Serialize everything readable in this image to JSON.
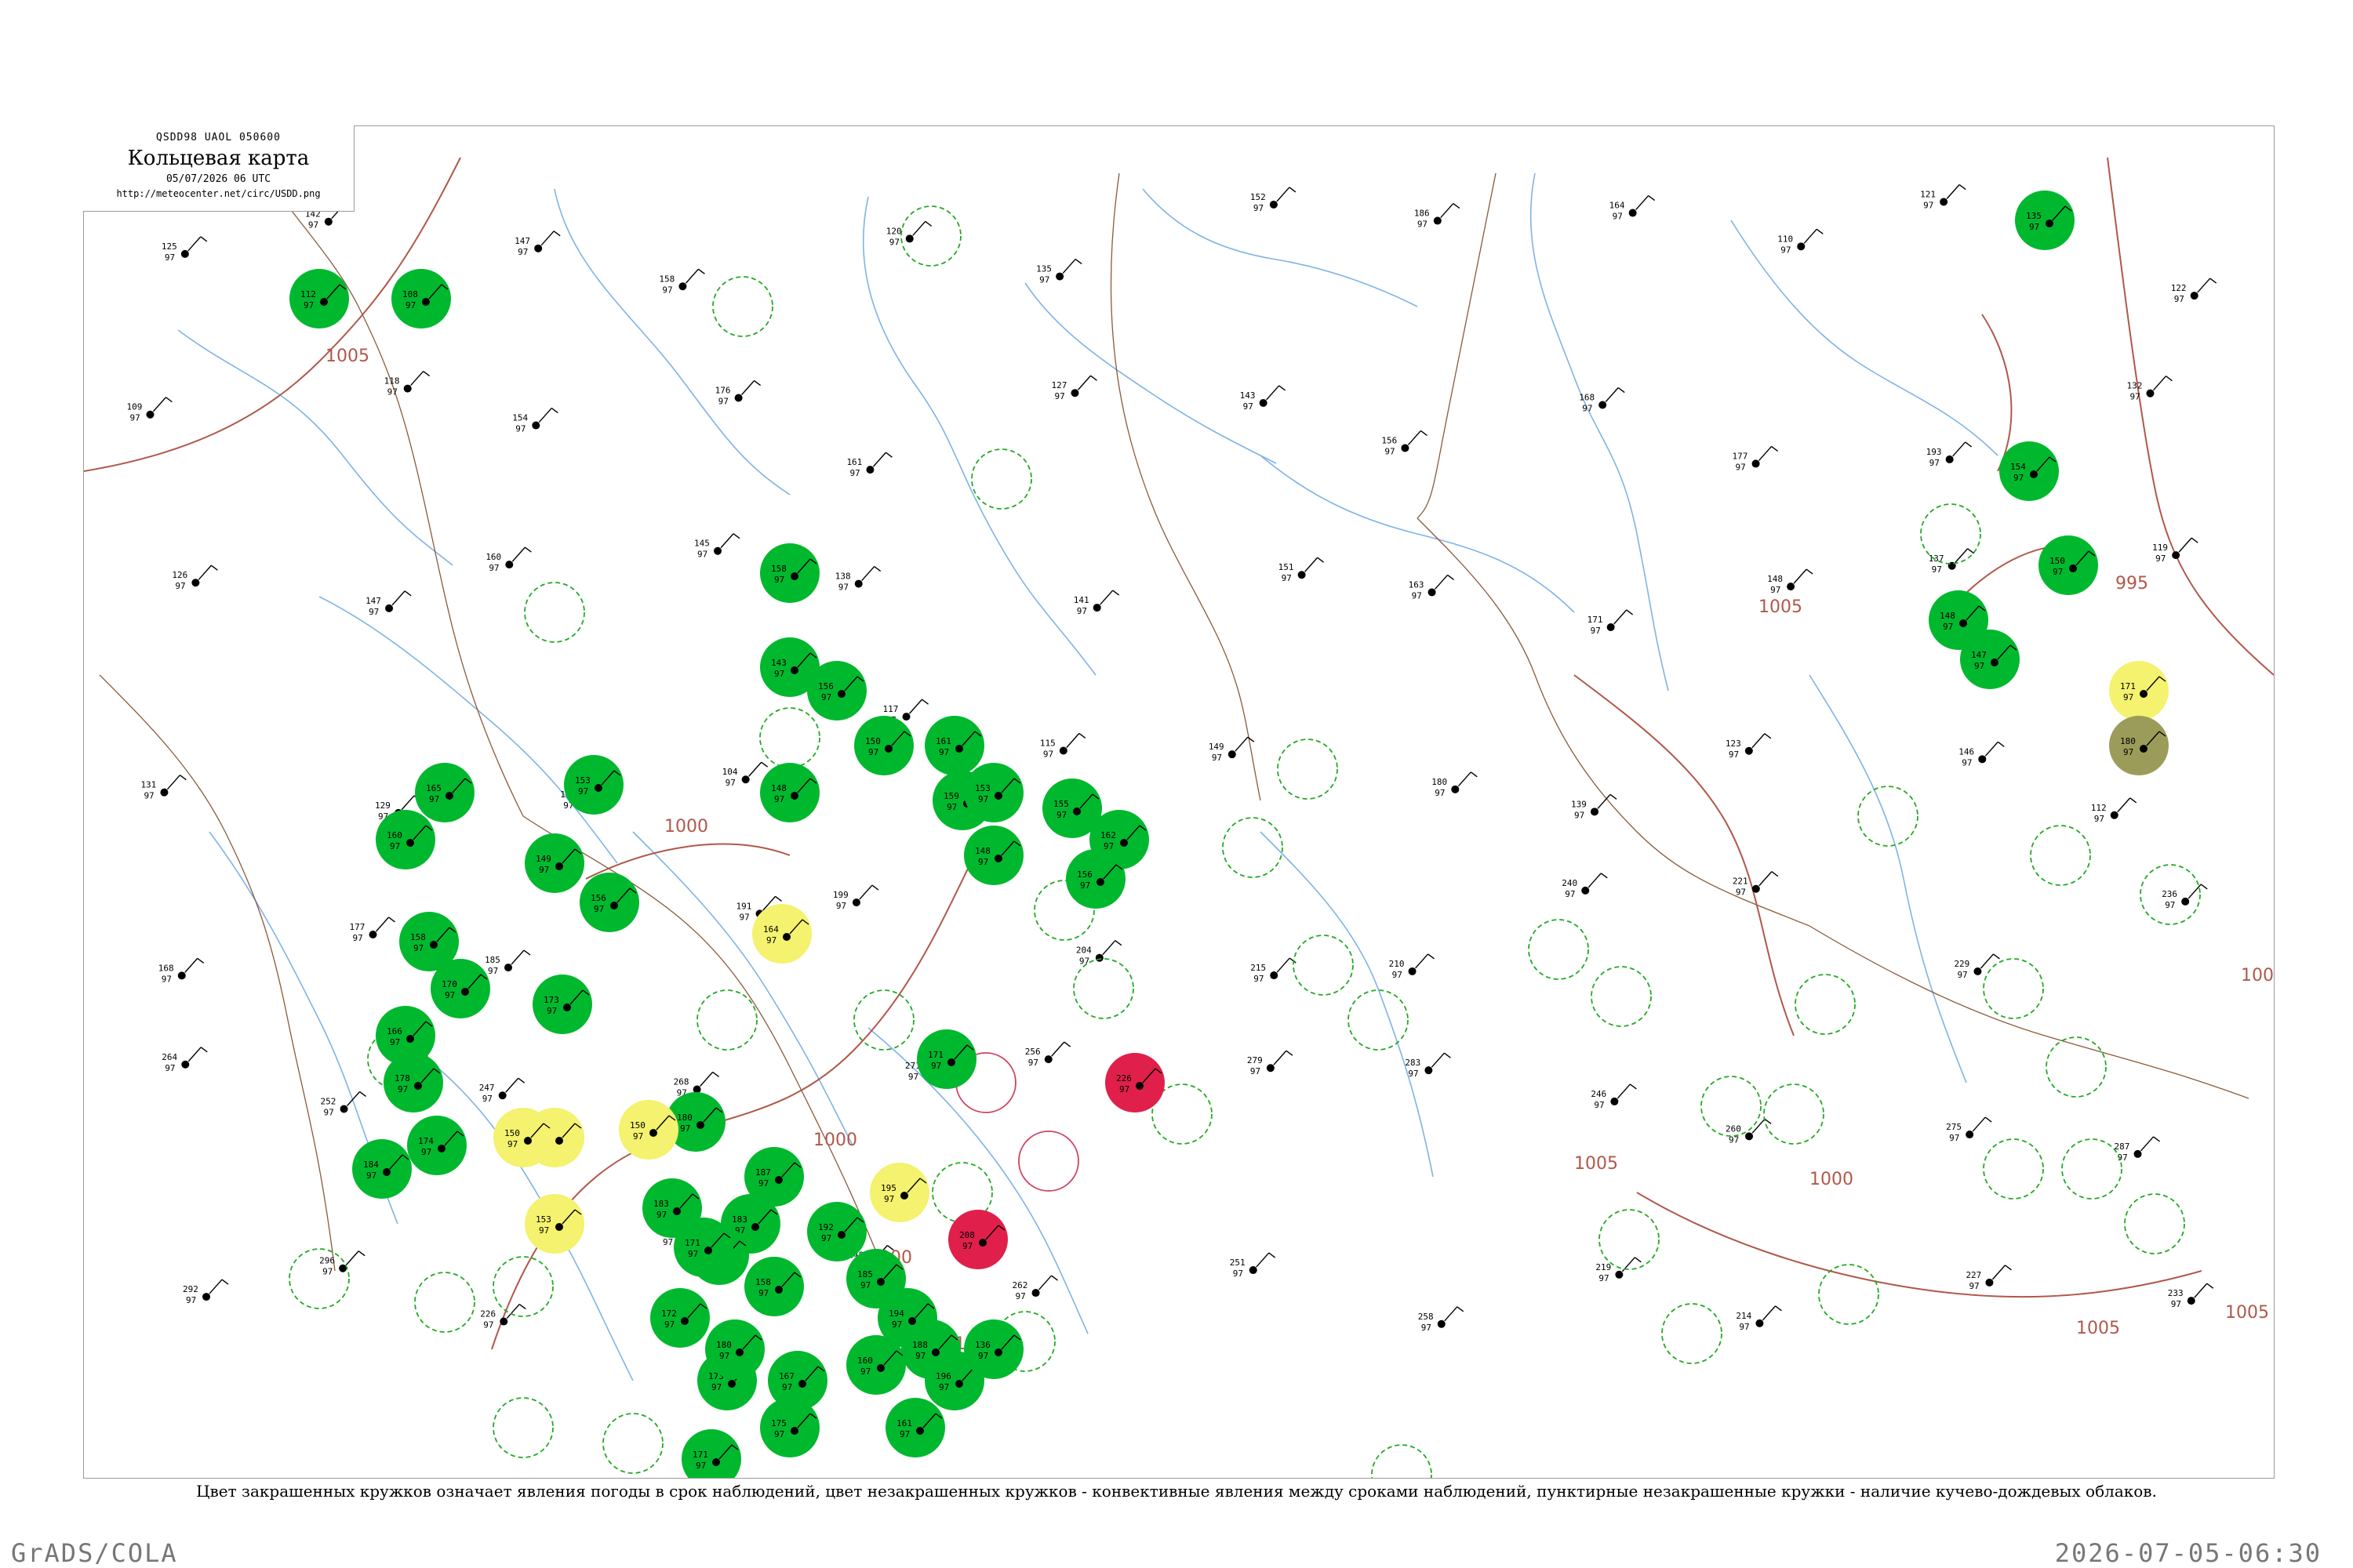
{
  "header": {
    "code": "QSDD98  UAOL  050600",
    "title": "Кольцевая карта",
    "date": "05/07/2026 06 UTC",
    "url": "http://meteocenter.net/circ/USDD.png"
  },
  "caption": "Цвет закрашенных кружков означает явления погоды в срок наблюдений, цвет незакрашенных кружков - конвективные явления между сроками наблюдений, пунктирные незакрашенные кружки - наличие кучево-дождевых облаков.",
  "footer": {
    "left": "GrADS/COLA",
    "right": "2026-07-05-06:30"
  },
  "colors": {
    "rain": "#00b82e",
    "drizzle": "#f4f26e",
    "shower_hail": "#9c9c5a",
    "thunder": "#e0204a",
    "cb_ring": "#22aa22",
    "convective_ring": "#d04060",
    "river": "#7fb3e6",
    "isobar": "#b0584a",
    "border": "#8a5a3a"
  },
  "isobar_labels": [
    "1005",
    "1000",
    "1000",
    "1000",
    "1000",
    "995",
    "1000",
    "1005",
    "1005",
    "1005",
    "1005",
    "100"
  ],
  "stations": [
    {
      "kind": "rain",
      "t1": "112",
      "t2": "97"
    },
    {
      "kind": "rain",
      "t1": "108",
      "t2": "97"
    },
    {
      "kind": "rain",
      "t1": "135",
      "t2": "97"
    },
    {
      "kind": "rain",
      "t1": "154",
      "t2": "97"
    },
    {
      "kind": "rain",
      "t1": "150",
      "t2": "97"
    },
    {
      "kind": "rain",
      "t1": "148",
      "t2": "97"
    },
    {
      "kind": "rain",
      "t1": "147",
      "t2": "97"
    },
    {
      "kind": "rain",
      "t1": "158",
      "t2": "97"
    },
    {
      "kind": "rain",
      "t1": "143",
      "t2": "97"
    },
    {
      "kind": "rain",
      "t1": "156",
      "t2": "97"
    },
    {
      "kind": "rain",
      "t1": "150",
      "t2": "97"
    },
    {
      "kind": "rain",
      "t1": "161",
      "t2": "97"
    },
    {
      "kind": "rain",
      "t1": "159",
      "t2": "97"
    },
    {
      "kind": "rain",
      "t1": "153",
      "t2": "97"
    },
    {
      "kind": "rain",
      "t1": "148",
      "t2": "97"
    },
    {
      "kind": "rain",
      "t1": "155",
      "t2": "97"
    },
    {
      "kind": "rain",
      "t1": "162",
      "t2": "97"
    },
    {
      "kind": "rain",
      "t1": "156",
      "t2": "97"
    },
    {
      "kind": "rain",
      "t1": "148",
      "t2": "97"
    },
    {
      "kind": "rain",
      "t1": "153",
      "t2": "97"
    },
    {
      "kind": "rain",
      "t1": "165",
      "t2": "97"
    },
    {
      "kind": "rain",
      "t1": "160",
      "t2": "97"
    },
    {
      "kind": "rain",
      "t1": "149",
      "t2": "97"
    },
    {
      "kind": "rain",
      "t1": "156",
      "t2": "97"
    },
    {
      "kind": "rain",
      "t1": "158",
      "t2": "97"
    },
    {
      "kind": "rain",
      "t1": "170",
      "t2": "97"
    },
    {
      "kind": "rain",
      "t1": "166",
      "t2": "97"
    },
    {
      "kind": "rain",
      "t1": "173",
      "t2": "97"
    },
    {
      "kind": "rain",
      "t1": "178",
      "t2": "97"
    },
    {
      "kind": "rain",
      "t1": "174",
      "t2": "97"
    },
    {
      "kind": "rain",
      "t1": "184",
      "t2": "97"
    },
    {
      "kind": "rain",
      "t1": "180",
      "t2": "97"
    },
    {
      "kind": "rain",
      "t1": "187",
      "t2": "97"
    },
    {
      "kind": "rain",
      "t1": "183",
      "t2": "97"
    },
    {
      "kind": "rain",
      "t1": "170",
      "t2": "97"
    },
    {
      "kind": "rain",
      "t1": "192",
      "t2": "97"
    },
    {
      "kind": "rain",
      "t1": "185",
      "t2": "97"
    },
    {
      "kind": "rain",
      "t1": "194",
      "t2": "97"
    },
    {
      "kind": "rain",
      "t1": "188",
      "t2": "97"
    },
    {
      "kind": "rain",
      "t1": "196",
      "t2": "97"
    },
    {
      "kind": "rain",
      "t1": "136",
      "t2": "97"
    },
    {
      "kind": "rain",
      "t1": "160",
      "t2": "97"
    },
    {
      "kind": "rain",
      "t1": "161",
      "t2": "97"
    },
    {
      "kind": "rain",
      "t1": "158",
      "t2": "97"
    },
    {
      "kind": "rain",
      "t1": "171",
      "t2": "97"
    },
    {
      "kind": "rain",
      "t1": "173",
      "t2": "97"
    },
    {
      "kind": "rain",
      "t1": "167",
      "t2": "97"
    },
    {
      "kind": "rain",
      "t1": "175",
      "t2": "97"
    },
    {
      "kind": "rain",
      "t1": "171",
      "t2": "97"
    },
    {
      "kind": "rain",
      "t1": "180",
      "t2": "97"
    },
    {
      "kind": "rain",
      "t1": "172",
      "t2": "97"
    },
    {
      "kind": "rain",
      "t1": "183",
      "t2": "97"
    },
    {
      "kind": "rain",
      "t1": "171",
      "t2": "97"
    },
    {
      "kind": "drizzle",
      "t1": "129",
      "t2": "97"
    },
    {
      "kind": "drizzle",
      "t1": "150",
      "t2": "97"
    },
    {
      "kind": "drizzle",
      "t1": "164",
      "t2": "97"
    },
    {
      "kind": "drizzle",
      "t1": "195",
      "t2": "97"
    },
    {
      "kind": "drizzle",
      "t1": "171",
      "t2": "97"
    },
    {
      "kind": "drizzle",
      "t1": "153",
      "t2": "97"
    },
    {
      "kind": "drizzle",
      "t1": "150",
      "t2": "97"
    },
    {
      "kind": "shower_hail",
      "t1": "180",
      "t2": "97"
    },
    {
      "kind": "thunder",
      "t1": "226",
      "t2": "97"
    },
    {
      "kind": "thunder",
      "t1": "208",
      "t2": "97"
    }
  ],
  "rings": [
    {
      "kind": "cb"
    },
    {
      "kind": "cb"
    },
    {
      "kind": "cb"
    },
    {
      "kind": "cb"
    },
    {
      "kind": "cb"
    },
    {
      "kind": "cb"
    },
    {
      "kind": "cb"
    },
    {
      "kind": "cb"
    },
    {
      "kind": "cb"
    },
    {
      "kind": "cb"
    },
    {
      "kind": "cb"
    },
    {
      "kind": "cb"
    },
    {
      "kind": "cb"
    },
    {
      "kind": "cb"
    },
    {
      "kind": "cb"
    },
    {
      "kind": "cb"
    },
    {
      "kind": "cb"
    },
    {
      "kind": "cb"
    },
    {
      "kind": "cb"
    },
    {
      "kind": "cb"
    },
    {
      "kind": "cb"
    },
    {
      "kind": "cb"
    },
    {
      "kind": "cb"
    },
    {
      "kind": "cb"
    },
    {
      "kind": "cb"
    },
    {
      "kind": "cb"
    },
    {
      "kind": "cb"
    },
    {
      "kind": "cb"
    },
    {
      "kind": "cb"
    },
    {
      "kind": "cb"
    },
    {
      "kind": "cb"
    },
    {
      "kind": "cb"
    },
    {
      "kind": "cb"
    },
    {
      "kind": "cb"
    },
    {
      "kind": "cb"
    },
    {
      "kind": "cb"
    },
    {
      "kind": "cb"
    },
    {
      "kind": "cb"
    },
    {
      "kind": "cb"
    },
    {
      "kind": "cb"
    },
    {
      "kind": "convective"
    },
    {
      "kind": "convective"
    }
  ],
  "plain_stations": [
    "125",
    "142",
    "147",
    "158",
    "120",
    "135",
    "152",
    "186",
    "164",
    "110",
    "121",
    "122",
    "109",
    "118",
    "154",
    "176",
    "161",
    "127",
    "143",
    "156",
    "168",
    "177",
    "193",
    "132",
    "126",
    "147",
    "160",
    "145",
    "138",
    "141",
    "151",
    "163",
    "171",
    "148",
    "137",
    "119",
    "131",
    "129",
    "111",
    "104",
    "117",
    "115",
    "149",
    "180",
    "139",
    "123",
    "146",
    "112",
    "168",
    "177",
    "185",
    "191",
    "199",
    "204",
    "215",
    "210",
    "240",
    "221",
    "229",
    "236",
    "264",
    "252",
    "247",
    "268",
    "271",
    "256",
    "279",
    "283",
    "246",
    "260",
    "275",
    "287",
    "292",
    "296",
    "226",
    "239",
    "248",
    "262",
    "251",
    "258",
    "219",
    "214",
    "227",
    "233"
  ]
}
